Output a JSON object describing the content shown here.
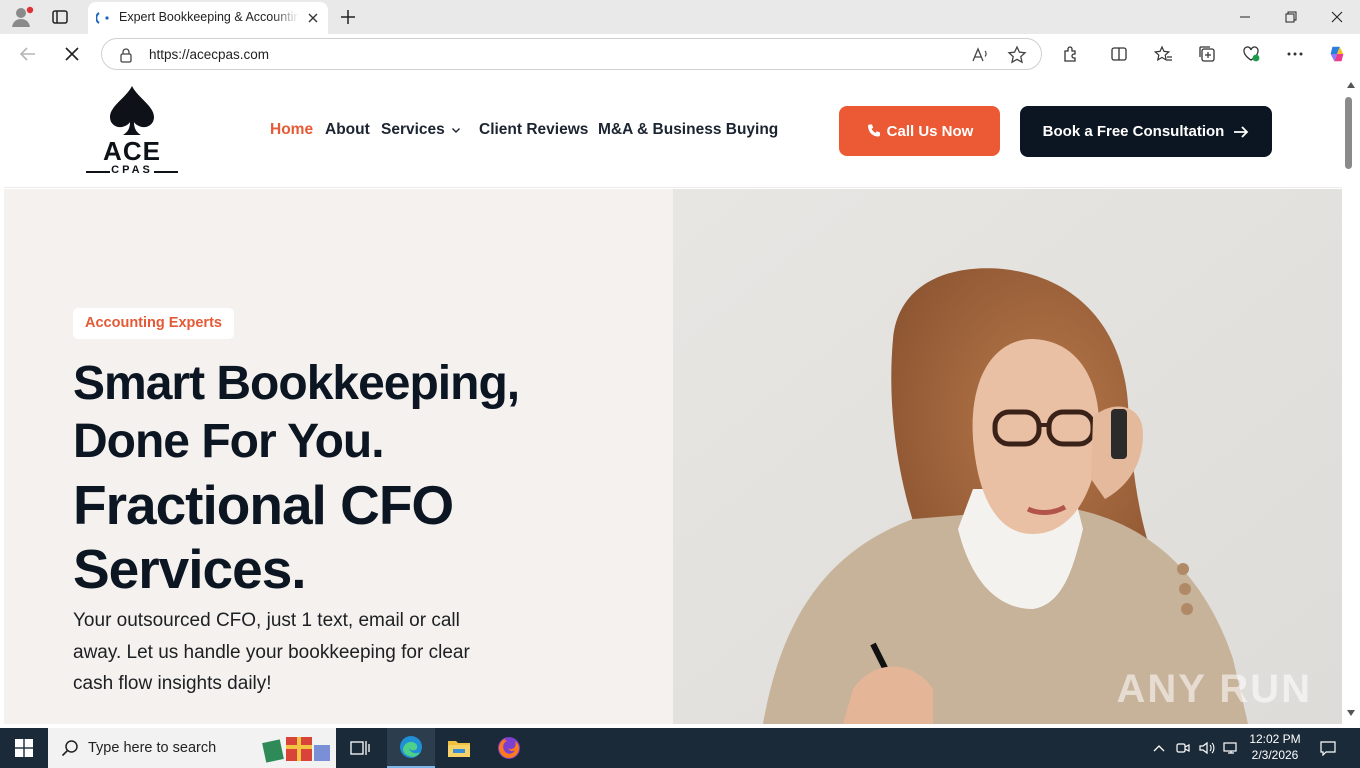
{
  "browser": {
    "tab": {
      "title": "Expert Bookkeeping & Accounting Services"
    },
    "url": "https://acecpas.com",
    "window_controls": [
      "minimize",
      "restore",
      "close"
    ]
  },
  "site": {
    "logo": {
      "name": "ACE",
      "sub": "CPAS"
    },
    "nav": {
      "home": "Home",
      "about": "About",
      "services": "Services",
      "reviews": "Client Reviews",
      "mna": "M&A & Business Buying"
    },
    "cta_call": "Call Us Now",
    "cta_book": "Book a Free Consultation",
    "hero": {
      "badge": "Accounting Experts",
      "headline_1": "Smart Bookkeeping, Done For You.",
      "headline_2": "Fractional CFO Services.",
      "subtext": "Your outsourced CFO, just 1 text, email or call away. Let us handle your bookkeeping for clear cash flow insights daily!"
    },
    "watermark": "ANY RUN"
  },
  "colors": {
    "accent": "#ec5a35",
    "dark": "#0c1622",
    "hero_bg": "#f4f1ee",
    "taskbar": "#1b2a38"
  },
  "taskbar": {
    "search_placeholder": "Type here to search",
    "apps": [
      "task-view-icon",
      "edge-icon",
      "file-explorer-icon",
      "firefox-icon"
    ],
    "clock": {
      "time": "12:02 PM",
      "date": "2/3/2026"
    }
  }
}
